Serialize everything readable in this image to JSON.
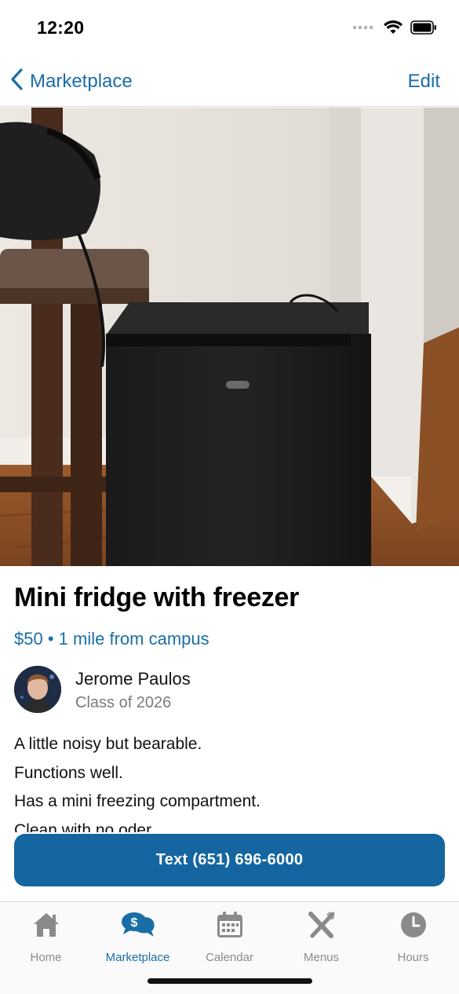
{
  "status_bar": {
    "time": "12:20"
  },
  "nav": {
    "back_label": "Marketplace",
    "edit_label": "Edit"
  },
  "listing": {
    "title": "Mini fridge with freezer",
    "price": "$50",
    "separator": "•",
    "distance": "1 mile from campus",
    "seller": {
      "name": "Jerome Paulos",
      "class": "Class of 2026"
    },
    "description": [
      "A little noisy but bearable.",
      "Functions well.",
      "Has a mini freezing compartment.",
      "Clean with no oder."
    ],
    "action_label": "Text (651) 696-6000"
  },
  "tabs": [
    {
      "label": "Home",
      "icon": "house-icon",
      "active": false
    },
    {
      "label": "Marketplace",
      "icon": "chat-dollar-icon",
      "active": true
    },
    {
      "label": "Calendar",
      "icon": "calendar-icon",
      "active": false
    },
    {
      "label": "Menus",
      "icon": "fork-knife-icon",
      "active": false
    },
    {
      "label": "Hours",
      "icon": "clock-icon",
      "active": false
    }
  ],
  "colors": {
    "accent": "#1a6ea8",
    "button": "#1566a0",
    "inactive": "#8a8a8a"
  }
}
